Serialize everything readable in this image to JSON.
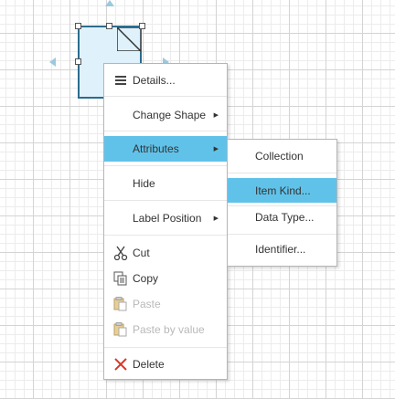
{
  "canvas": {
    "grid_color": "#d4d4d4",
    "shape_fill": "#dff1fb",
    "shape_border": "#2b6c8e",
    "hint_arrow_color": "#9cc9dd"
  },
  "context_menu": {
    "highlight_color": "#61c2e9",
    "items": [
      {
        "label": "Details...",
        "icon": "list-icon"
      },
      {
        "label": "Change Shape",
        "submenu": true
      },
      {
        "label": "Attributes",
        "submenu": true,
        "active": true
      },
      {
        "label": "Hide"
      },
      {
        "label": "Label Position",
        "submenu": true
      },
      {
        "label": "Cut",
        "icon": "scissors-icon"
      },
      {
        "label": "Copy",
        "icon": "copy-icon"
      },
      {
        "label": "Paste",
        "icon": "paste-icon",
        "disabled": true
      },
      {
        "label": "Paste by value",
        "icon": "paste-icon",
        "disabled": true
      },
      {
        "label": "Delete",
        "icon": "delete-x-icon"
      }
    ]
  },
  "submenu": {
    "items": [
      {
        "label": "Collection"
      },
      {
        "label": "Item Kind...",
        "active": true
      },
      {
        "label": "Data Type..."
      },
      {
        "label": "Identifier..."
      }
    ]
  }
}
